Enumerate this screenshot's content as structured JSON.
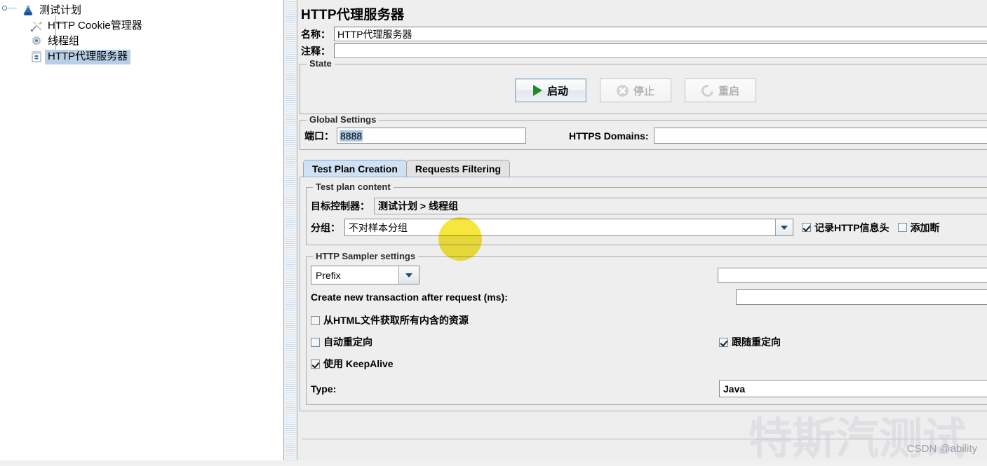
{
  "tree": {
    "items": [
      {
        "label": "测试计划",
        "icon": "test-plan-icon",
        "depth": 0,
        "selected": false
      },
      {
        "label": "HTTP Cookie管理器",
        "icon": "cookie-manager-icon",
        "depth": 1,
        "selected": false
      },
      {
        "label": "线程组",
        "icon": "thread-group-icon",
        "depth": 1,
        "selected": false
      },
      {
        "label": "HTTP代理服务器",
        "icon": "http-proxy-server-icon",
        "depth": 1,
        "selected": true
      }
    ]
  },
  "main": {
    "title": "HTTP代理服务器",
    "name_label": "名称：",
    "name_value": "HTTP代理服务器",
    "comment_label": "注释：",
    "comment_value": "",
    "state": {
      "group_title": "State",
      "start_label": "启动",
      "stop_label": "停止",
      "restart_label": "重启"
    },
    "global_settings": {
      "group_title": "Global Settings",
      "port_label": "端口：",
      "port_value": "8888",
      "https_domains_label": "HTTPS Domains:",
      "https_domains_value": ""
    },
    "tabs": [
      {
        "label": "Test Plan Creation",
        "active": true
      },
      {
        "label": "Requests Filtering",
        "active": false
      }
    ],
    "test_plan_content": {
      "group_title": "Test plan content",
      "target_controller_label": "目标控制器：",
      "target_controller_value": "测试计划 > 线程组",
      "grouping_label": "分组：",
      "grouping_value": "不对样本分组",
      "capture_http_headers_label": "记录HTTP信息头",
      "capture_http_headers_checked": true,
      "add_assertions_label": "添加断",
      "add_assertions_checked": false
    },
    "sampler_settings": {
      "group_title": "HTTP Sampler settings",
      "prefix_label": "Prefix",
      "prefix_value": "",
      "transaction_label": "Create new transaction after request (ms):",
      "transaction_value": "",
      "retrieve_embedded_label": "从HTML文件获取所有内含的资源",
      "retrieve_embedded_checked": false,
      "auto_redirect_label": "自动重定向",
      "auto_redirect_checked": false,
      "follow_redirect_label": "跟随重定向",
      "follow_redirect_checked": true,
      "keepalive_label": "使用 KeepAlive",
      "keepalive_checked": true,
      "type_label": "Type:",
      "type_value": "Java"
    }
  },
  "watermark": {
    "background_text": "特斯汽测试",
    "credit": "CSDN @ability"
  },
  "colors": {
    "selection_blue": "#b8cfe5",
    "active_tab": "#cfe1f2",
    "start_green": "#1d8f1d",
    "spotlight_yellow": "#f2e006",
    "panel_gray": "#eeeeee"
  }
}
